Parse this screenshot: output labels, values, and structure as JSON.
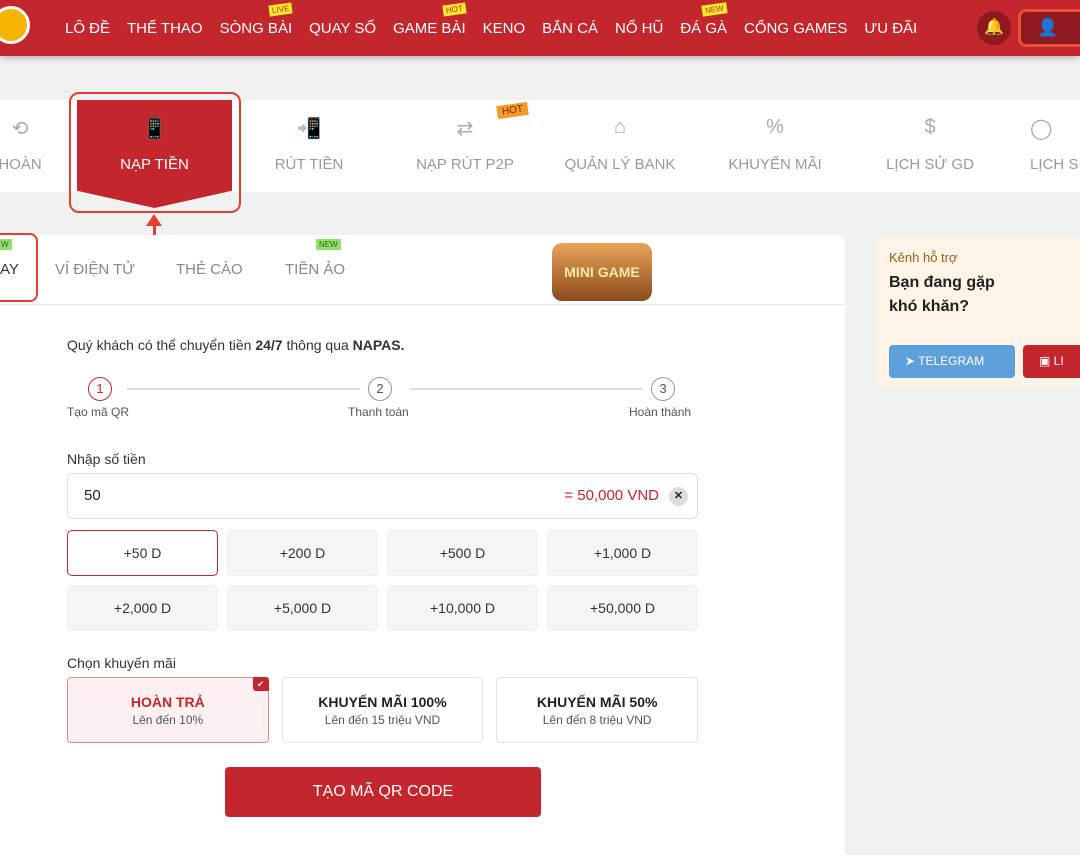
{
  "header": {
    "nav": [
      {
        "label": "LÔ ĐỀ"
      },
      {
        "label": "THỂ THAO"
      },
      {
        "label": "SÒNG BÀI",
        "badge": "LIVE"
      },
      {
        "label": "QUAY SỐ"
      },
      {
        "label": "GAME BÀI",
        "badge": "HOT"
      },
      {
        "label": "KENO"
      },
      {
        "label": "BẮN CÁ"
      },
      {
        "label": "NỔ HŨ"
      },
      {
        "label": "ĐÁ GÀ",
        "badge": "NEW"
      },
      {
        "label": "CỔNG GAMES"
      },
      {
        "label": "ƯU ĐÃI"
      }
    ],
    "bell_icon": "bell-icon",
    "user_icon": "user-icon"
  },
  "tabs": [
    {
      "label": "HOÀN"
    },
    {
      "label": "NẠP TIỀN"
    },
    {
      "label": "RÚT TIỀN"
    },
    {
      "label": "NẠP RÚT P2P",
      "badge": "HOT"
    },
    {
      "label": "QUẢN LÝ BANK"
    },
    {
      "label": "KHUYẾN MÃI"
    },
    {
      "label": "LỊCH SỬ GD"
    },
    {
      "label": "LỊCH S"
    }
  ],
  "subtabs": [
    {
      "label": "AY",
      "badge": "W"
    },
    {
      "label": "VÍ ĐIỆN TỬ"
    },
    {
      "label": "THẺ CÀO"
    },
    {
      "label": "TIỀN ẢO",
      "badge": "NEW"
    }
  ],
  "minigame": "MINI GAME",
  "intro": {
    "pre": "Quý khách có thể chuyển tiền ",
    "b1": "24/7",
    "mid": " thông qua ",
    "b2": "NAPAS."
  },
  "steps": [
    {
      "n": "1",
      "label": "Tạo mã QR"
    },
    {
      "n": "2",
      "label": "Thanh toán"
    },
    {
      "n": "3",
      "label": "Hoàn thành"
    }
  ],
  "amount": {
    "label": "Nhập số tiền",
    "value": "50",
    "converted": "= 50,000 VND"
  },
  "quick": [
    "+50 D",
    "+200 D",
    "+500 D",
    "+1,000 D",
    "+2,000 D",
    "+5,000 D",
    "+10,000 D",
    "+50,000 D"
  ],
  "promo": {
    "label": "Chọn khuyến mãi",
    "items": [
      {
        "title": "HOÀN TRẢ",
        "sub": "Lên đến 10%"
      },
      {
        "title": "KHUYẾN MÃI 100%",
        "sub": "Lên đến 15 triệu VND"
      },
      {
        "title": "KHUYẾN MÃI 50%",
        "sub": "Lên đến 8 triệu VND"
      }
    ]
  },
  "cta": "TẠO MÃ QR CODE",
  "support": {
    "kicker": "Kênh hỗ trợ",
    "heading": "Bạn đang gặp khó khăn?",
    "telegram": "TELEGRAM",
    "live": "LI"
  },
  "colors": {
    "brand": "#c3272d",
    "telegram": "#5ea0dc"
  }
}
